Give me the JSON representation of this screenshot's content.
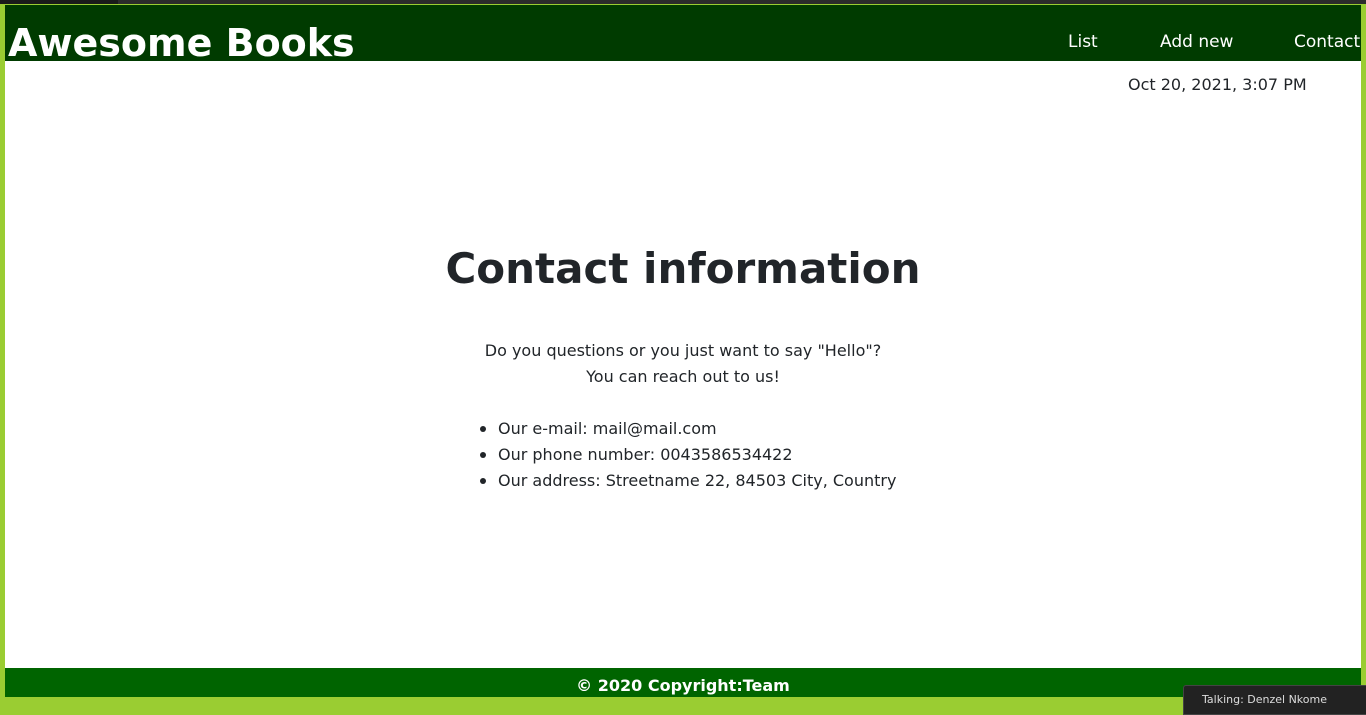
{
  "header": {
    "brand": "Awesome Books",
    "nav": [
      "List",
      "Add new",
      "Contact"
    ]
  },
  "datetime": "Oct 20, 2021, 3:07 PM",
  "contact": {
    "title": "Contact information",
    "intro_line1": "Do you questions or you just want to say \"Hello\"?",
    "intro_line2": "You can reach out to us!",
    "items": [
      "Our e-mail: mail@mail.com",
      "Our phone number: 0043586534422",
      "Our address: Streetname 22, 84503 City, Country"
    ]
  },
  "footer": {
    "text": "© 2020 Copyright:Team"
  },
  "notification": {
    "text": "Talking: Denzel Nkome"
  },
  "colors": {
    "navbar_bg": "#003b00",
    "footer_bg": "#006400",
    "frame_border": "#9acd32",
    "text_dark": "#212529"
  }
}
